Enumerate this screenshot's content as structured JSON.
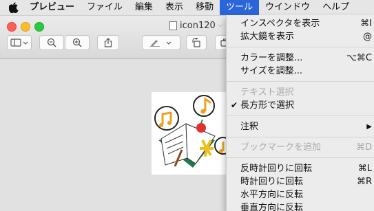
{
  "menubar": {
    "app": "プレビュー",
    "items": [
      "ファイル",
      "編集",
      "表示",
      "移動",
      "ツール",
      "ウインドウ",
      "ヘルプ"
    ],
    "active_index": 4
  },
  "window": {
    "title": "icon120"
  },
  "tools_menu": {
    "items": [
      {
        "label": "インスペクタを表示",
        "shortcut": "⌘I",
        "enabled": true
      },
      {
        "label": "拡大鏡を表示",
        "shortcut": "@",
        "enabled": true
      },
      {
        "label": "カラーを調整...",
        "shortcut": "⌥⌘C",
        "enabled": true
      },
      {
        "label": "サイズを調整...",
        "shortcut": "",
        "enabled": true
      },
      {
        "label": "テキスト選択",
        "shortcut": "",
        "enabled": false
      },
      {
        "label": "長方形で選択",
        "shortcut": "",
        "enabled": true,
        "checked": true
      },
      {
        "label": "注釈",
        "shortcut": "▶",
        "enabled": true
      },
      {
        "label": "ブックマークを追加",
        "shortcut": "⌘D",
        "enabled": false
      },
      {
        "label": "反時計回りに回転",
        "shortcut": "⌘L",
        "enabled": true
      },
      {
        "label": "時計回りに回転",
        "shortcut": "⌘R",
        "enabled": true
      },
      {
        "label": "水平方向に反転",
        "shortcut": "",
        "enabled": true
      },
      {
        "label": "垂直方向に反転",
        "shortcut": "",
        "enabled": true
      }
    ]
  },
  "colors": {
    "menu_highlight": "#2a66d9",
    "accent_orange": "#f0a020"
  }
}
